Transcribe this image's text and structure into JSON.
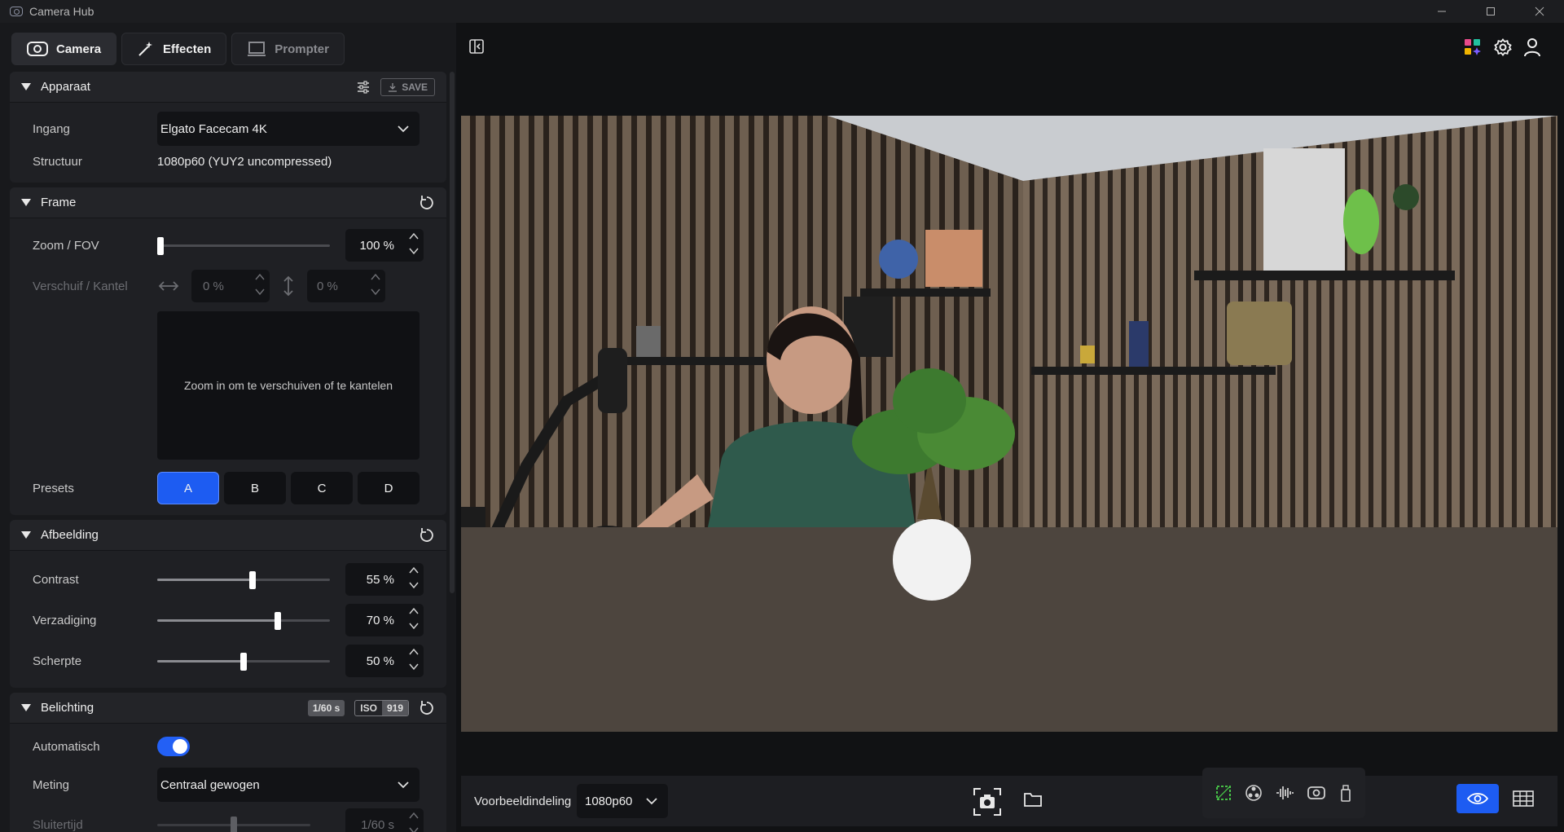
{
  "app": {
    "title": "Camera Hub"
  },
  "tabs": [
    {
      "label": "Camera",
      "icon": "camera-icon"
    },
    {
      "label": "Effecten",
      "icon": "magic-wand-icon"
    },
    {
      "label": "Prompter",
      "icon": "prompter-icon"
    }
  ],
  "device": {
    "title": "Apparaat",
    "save_label": "SAVE",
    "input_label": "Ingang",
    "input_value": "Elgato Facecam 4K",
    "format_label": "Structuur",
    "format_value": "1080p60 (YUY2 uncompressed)"
  },
  "frame": {
    "title": "Frame",
    "zoom_label": "Zoom / FOV",
    "zoom_value": "100 %",
    "zoom_level": 0,
    "pantilt_label": "Verschuif / Kantel",
    "pan_value": "0 %",
    "tilt_value": "0 %",
    "pad_hint": "Zoom in om te verschuiven of te kantelen",
    "presets_label": "Presets",
    "presets": [
      "A",
      "B",
      "C",
      "D"
    ],
    "active_preset": "A"
  },
  "image": {
    "title": "Afbeelding",
    "controls": [
      {
        "label": "Contrast",
        "value": "55 %",
        "level": 0.55
      },
      {
        "label": "Verzadiging",
        "value": "70 %",
        "level": 0.7
      },
      {
        "label": "Scherpte",
        "value": "50 %",
        "level": 0.5
      }
    ]
  },
  "exposure": {
    "title": "Belichting",
    "shutter_badge": "1/60 s",
    "iso_key": "ISO",
    "iso_value": "919",
    "auto_label": "Automatisch",
    "auto_on": true,
    "metering_label": "Meting",
    "metering_value": "Centraal gewogen",
    "shutter_label": "Sluitertijd",
    "shutter_value": "1/60 s",
    "shutter_level": 0.5
  },
  "bottom": {
    "layout_label": "Voorbeeldindeling",
    "layout_value": "1080p60"
  },
  "colors": {
    "accent": "#1d5cf2",
    "panel": "#1f2024",
    "background": "#18191c"
  }
}
